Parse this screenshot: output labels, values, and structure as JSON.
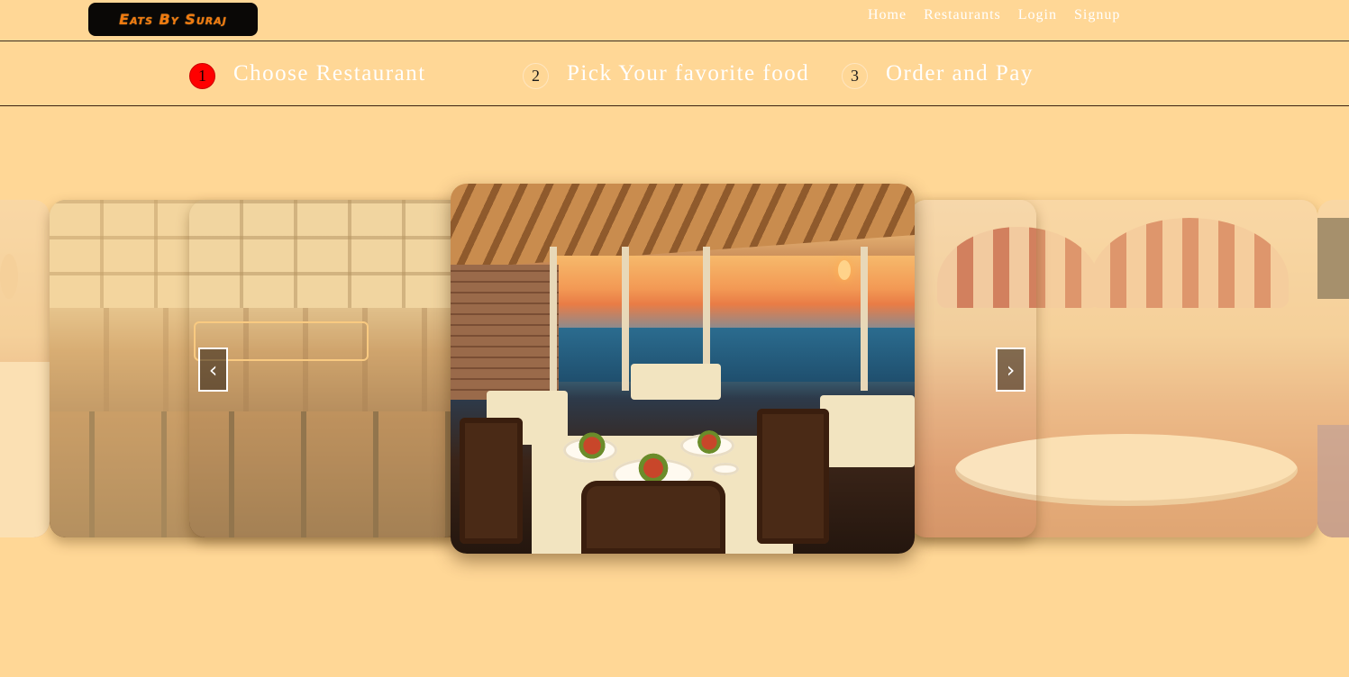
{
  "header": {
    "logo_text": "Eats By Suraj",
    "nav": [
      "Home",
      "Restaurants",
      "Login",
      "Signup"
    ]
  },
  "steps": [
    {
      "number": "1",
      "label": "Choose Restaurant",
      "active": true
    },
    {
      "number": "2",
      "label": "Pick Your favorite food",
      "active": false
    },
    {
      "number": "3",
      "label": "Order and Pay",
      "active": false
    }
  ],
  "carousel": {
    "prev_icon": "chevron-left-icon",
    "prev_symbol": "‹",
    "next_icon": "chevron-right-icon",
    "next_symbol": "›",
    "slides": [
      {
        "name": "lounge-slide",
        "state": "far-left"
      },
      {
        "name": "thai-bar-slide",
        "state": "left"
      },
      {
        "name": "ocean-view-slide",
        "state": "active"
      },
      {
        "name": "garden-tea-slide",
        "state": "right"
      },
      {
        "name": "terrace-slide",
        "state": "far-right"
      }
    ]
  },
  "colors": {
    "background": "#ffd796",
    "logo_bg": "#0a0806",
    "logo_text": "#f07a0f",
    "active_step": "#ff0000",
    "nav_text": "#ffffff"
  }
}
